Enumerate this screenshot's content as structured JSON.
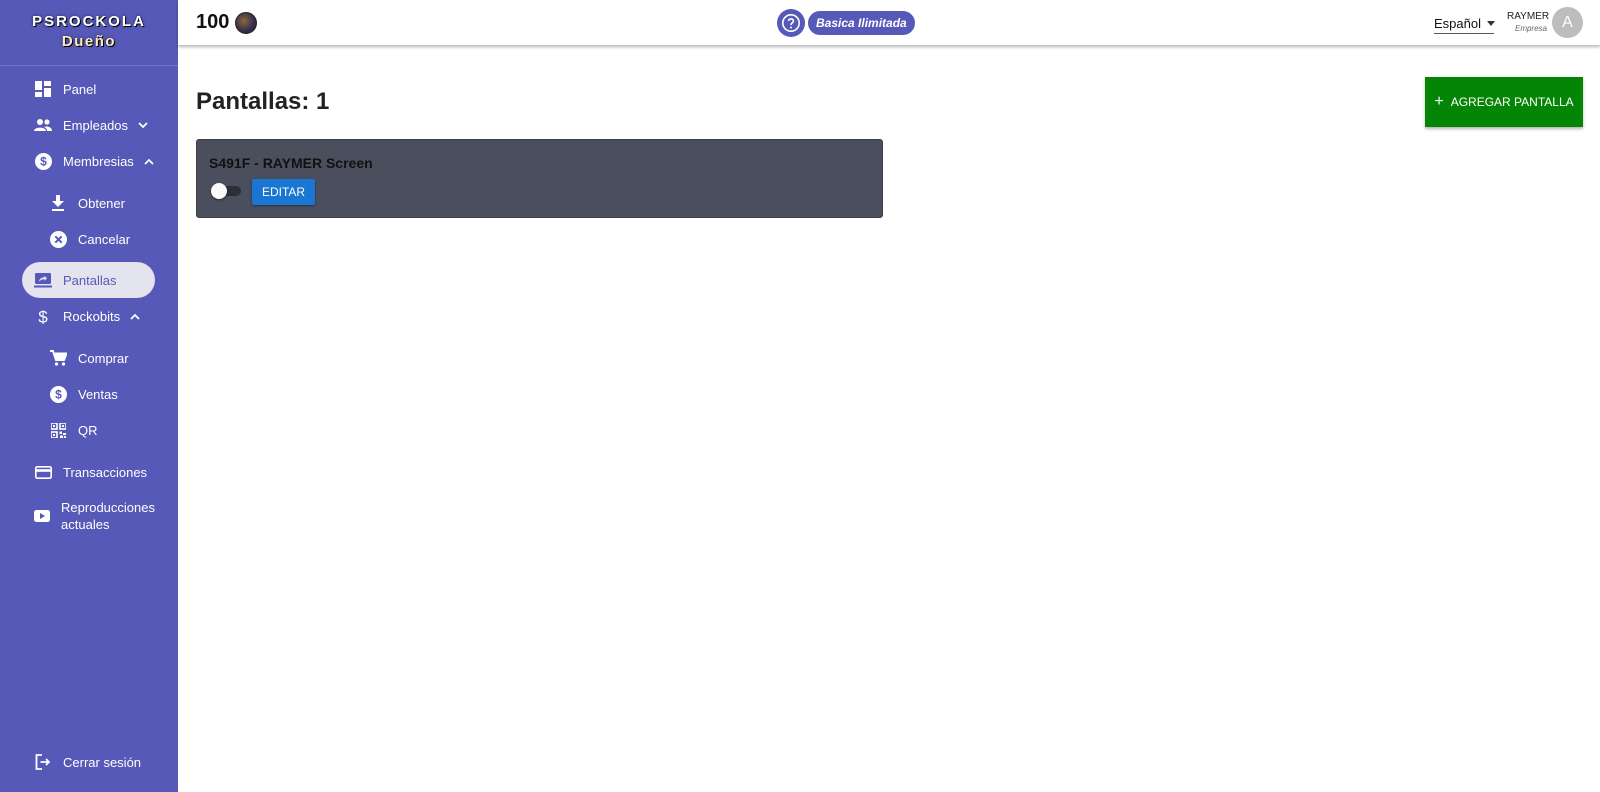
{
  "brand": {
    "line1": "PSROCKOLA",
    "line2": "Dueño"
  },
  "sidebar": {
    "items": [
      {
        "label": "Panel",
        "icon": "dashboard-icon"
      },
      {
        "label": "Empleados",
        "icon": "people-icon",
        "expanded": false
      },
      {
        "label": "Membresias",
        "icon": "dollar-circle-icon",
        "expanded": true
      },
      {
        "label": "Obtener",
        "icon": "download-icon"
      },
      {
        "label": "Cancelar",
        "icon": "cancel-icon"
      },
      {
        "label": "Pantallas",
        "icon": "screen-share-icon",
        "active": true
      },
      {
        "label": "Rockobits",
        "icon": "dollar-icon",
        "expanded": true
      },
      {
        "label": "Comprar",
        "icon": "cart-icon"
      },
      {
        "label": "Ventas",
        "icon": "dollar-circle-icon"
      },
      {
        "label": "QR",
        "icon": "qr-icon"
      },
      {
        "label": "Transacciones",
        "icon": "credit-card-icon"
      },
      {
        "label": "Reproducciones actuales",
        "icon": "youtube-icon"
      }
    ],
    "logout": {
      "label": "Cerrar sesión",
      "icon": "logout-icon"
    }
  },
  "header": {
    "credits": "100",
    "plan": "Basica Ilimitada",
    "language": "Español",
    "user_name": "RAYMER",
    "user_role": "Empresa",
    "avatar_initial": "A"
  },
  "main": {
    "title": "Pantallas: 1",
    "add_button": "AGREGAR PANTALLA",
    "screens": [
      {
        "name": "S491F - RAYMER Screen",
        "enabled": false,
        "edit_label": "EDITAR"
      }
    ]
  },
  "colors": {
    "sidebar": "#5659b7",
    "add_button": "#058505",
    "edit_button": "#1976d2",
    "card": "#4b4f5d"
  }
}
